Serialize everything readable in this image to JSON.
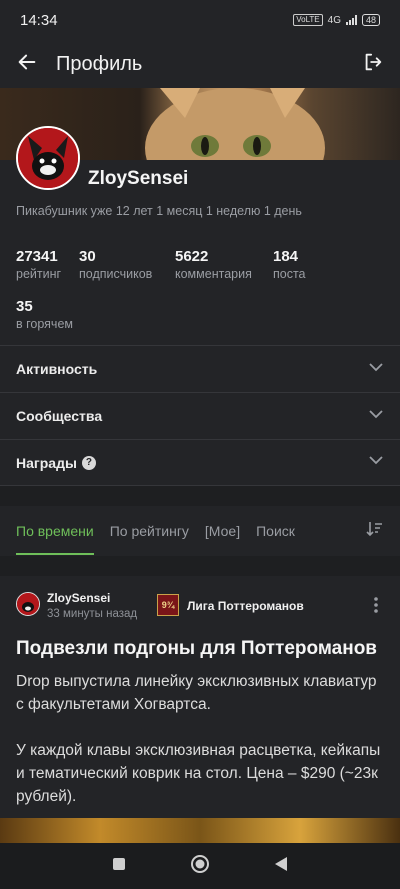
{
  "status": {
    "time": "14:34",
    "net_chip": "VoLTE",
    "net": "4G",
    "battery": "48"
  },
  "header": {
    "title": "Профиль"
  },
  "profile": {
    "username": "ZloySensei",
    "tenure": "Пикабушник уже 12 лет 1 месяц 1 неделю 1 день",
    "stats": [
      {
        "value": "27341",
        "label": "рейтинг"
      },
      {
        "value": "30",
        "label": "подписчиков"
      },
      {
        "value": "5622",
        "label": "комментария"
      },
      {
        "value": "184",
        "label": "поста"
      },
      {
        "value": "35",
        "label": "в горячем"
      }
    ]
  },
  "sections": [
    {
      "label": "Активность"
    },
    {
      "label": "Сообщества"
    },
    {
      "label": "Награды",
      "help": "?"
    }
  ],
  "tabs": [
    {
      "label": "По времени",
      "active": true
    },
    {
      "label": "По рейтингу"
    },
    {
      "label": "[Мое]"
    },
    {
      "label": "Поиск"
    }
  ],
  "post": {
    "author": "ZloySensei",
    "time": "33 минуты назад",
    "community_badge": "9¾",
    "community": "Лига Поттероманов",
    "title": "Подвезли подгоны для Поттероманов",
    "paragraph1": "Drop выпустила линейку эксклюзивных клавиатур с факультетами Хогвартса.",
    "paragraph2": "У каждой клавы эксклюзивная расцветка, кейкапы и тематический коврик на стол. Цена – $290 (~23к рублей)."
  },
  "colors": {
    "accent": "#6fbf5a",
    "background": "#1e1f21",
    "card": "#232427"
  }
}
